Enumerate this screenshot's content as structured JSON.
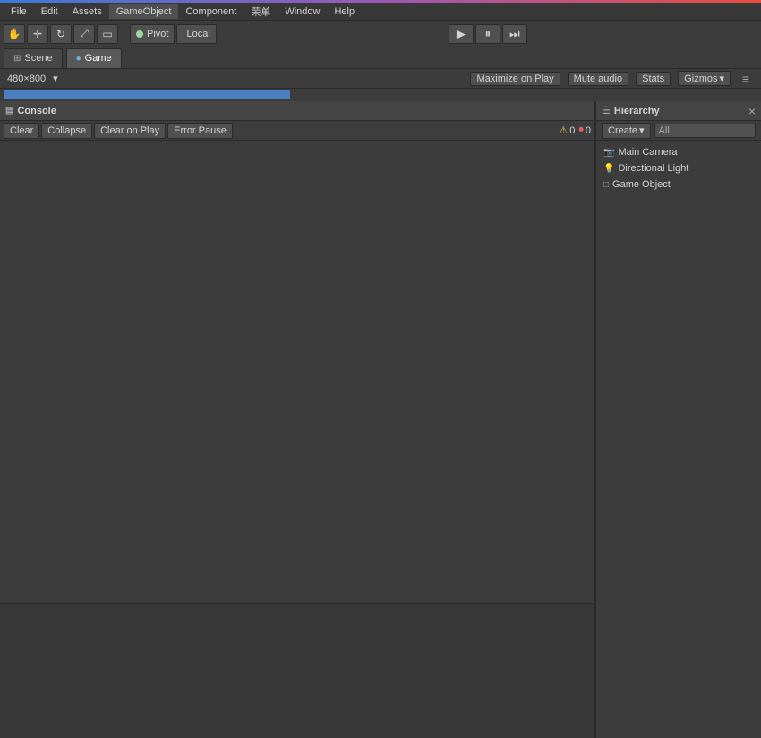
{
  "topGradient": true,
  "menuBar": {
    "items": [
      "File",
      "Edit",
      "Assets",
      "GameObject",
      "Component",
      "荣单",
      "Window",
      "Help"
    ]
  },
  "toolbar": {
    "pivotLabel": "Pivot",
    "localLabel": "Local",
    "playBtn": "▶",
    "pauseBtn": "⏸",
    "stepBtn": "⏭"
  },
  "tabs": {
    "scene": {
      "label": "Scene",
      "icon": "⊞",
      "active": false
    },
    "game": {
      "label": "Game",
      "icon": "●",
      "active": true
    }
  },
  "gameViewBar": {
    "resolution": "480×800",
    "maximizeLabel": "Maximize on Play",
    "muteLabel": "Mute audio",
    "statsLabel": "Stats",
    "gizmosLabel": "Gizmos"
  },
  "console": {
    "title": "Console",
    "icon": "▤",
    "buttons": {
      "clear": "Clear",
      "collapse": "Collapse",
      "clearOnPlay": "Clear on Play",
      "errorPause": "Error Pause"
    },
    "badges": {
      "warnings": {
        "count": "0",
        "icon": "⚠"
      },
      "errors": {
        "count": "0",
        "icon": "🔴"
      }
    }
  },
  "hierarchy": {
    "title": "Hierarchy",
    "icon": "☰",
    "create": "Create",
    "all": "All",
    "items": [
      {
        "label": "Main Camera",
        "icon": "🎥"
      },
      {
        "label": "Directional Light",
        "icon": "💡"
      },
      {
        "label": "Game Object",
        "icon": "□"
      }
    ]
  }
}
